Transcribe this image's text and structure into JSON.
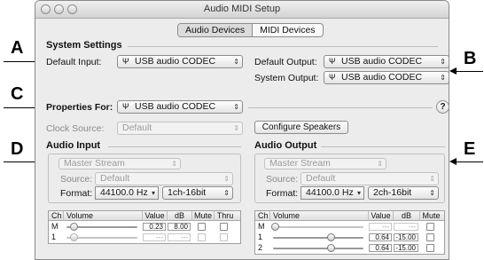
{
  "callouts": {
    "a": "A",
    "b": "B",
    "c": "C",
    "d": "D",
    "e": "E"
  },
  "window": {
    "title": "Audio MIDI Setup"
  },
  "tabs": [
    {
      "label": "Audio Devices",
      "selected": true
    },
    {
      "label": "MIDI Devices",
      "selected": false
    }
  ],
  "system_settings": {
    "title": "System Settings",
    "default_input_label": "Default Input:",
    "default_input_value": "USB audio CODEC",
    "default_output_label": "Default Output:",
    "default_output_value": "USB audio CODEC",
    "system_output_label": "System Output:",
    "system_output_value": "USB audio CODEC"
  },
  "properties": {
    "label": "Properties For:",
    "value": "USB audio CODEC",
    "clock_source_label": "Clock Source:",
    "clock_source_value": "Default",
    "configure_speakers": "Configure Speakers",
    "help": "?"
  },
  "audio_input": {
    "title": "Audio Input",
    "stream": "Master Stream",
    "source_label": "Source:",
    "source_value": "Default",
    "format_label": "Format:",
    "format_rate": "44100.0 Hz",
    "format_bits": "1ch-16bit",
    "columns": [
      "Ch",
      "Volume",
      "Value",
      "dB",
      "Mute",
      "Thru"
    ],
    "rows": [
      {
        "ch": "M",
        "volume": 0.1,
        "value": "0.23",
        "db": "8.00",
        "enabled": true
      },
      {
        "ch": "1",
        "volume": 0.1,
        "value": "---",
        "db": "---",
        "enabled": false
      }
    ]
  },
  "audio_output": {
    "title": "Audio Output",
    "stream": "Master Stream",
    "source_label": "Source:",
    "source_value": "Default",
    "format_label": "Format:",
    "format_rate": "44100.0 Hz",
    "format_bits": "2ch-16bit",
    "columns": [
      "Ch",
      "Volume",
      "Value",
      "dB",
      "Mute"
    ],
    "rows": [
      {
        "ch": "M",
        "volume": 0.02,
        "value": "---",
        "db": "---",
        "enabled": false
      },
      {
        "ch": "1",
        "volume": 0.64,
        "value": "0.64",
        "db": "-15.00",
        "enabled": true
      },
      {
        "ch": "2",
        "volume": 0.64,
        "value": "0.64",
        "db": "-15.00",
        "enabled": true
      }
    ]
  }
}
